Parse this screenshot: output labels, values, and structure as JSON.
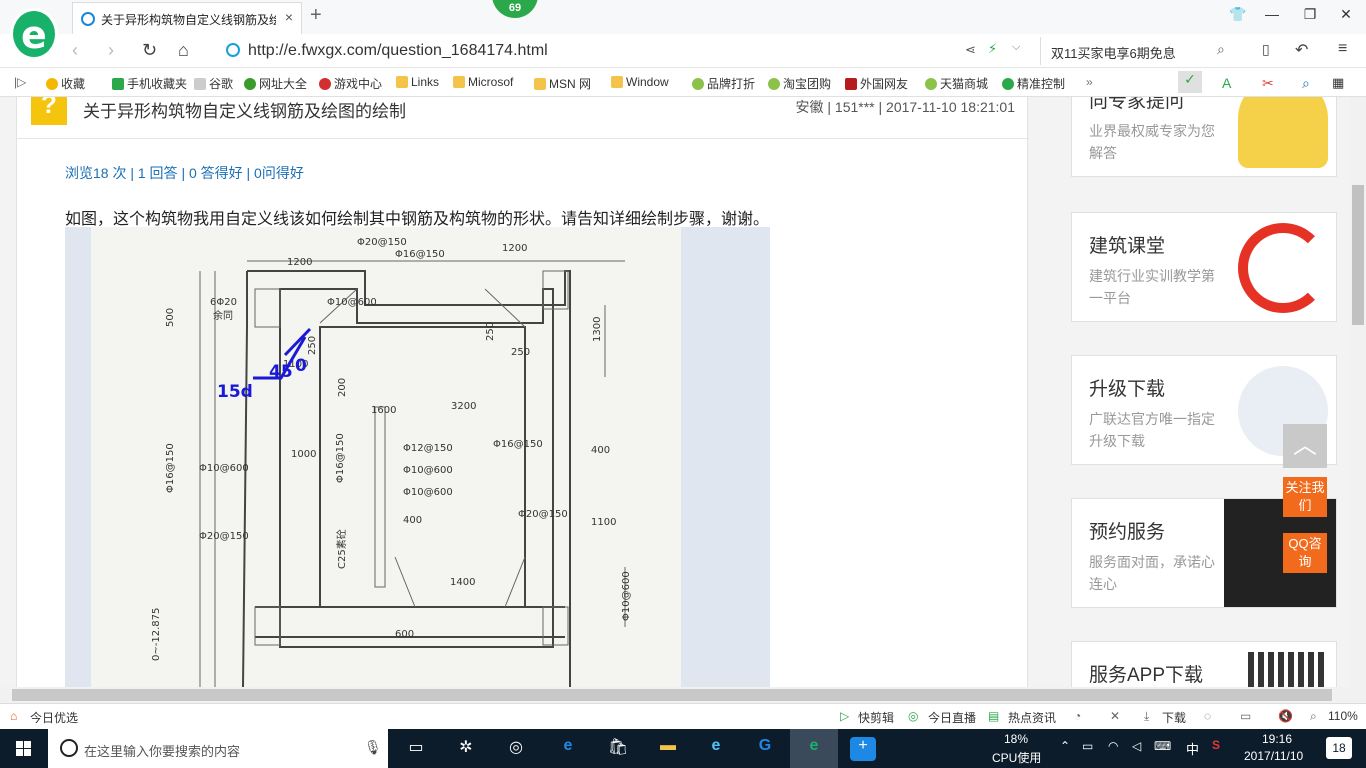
{
  "browser": {
    "tab_title": "关于异形构筑物自定义线钢筋及绘",
    "tab_close": "×",
    "new_tab": "+",
    "badge": "69",
    "url": "http://e.fwxgx.com/question_1684174.html",
    "search_text": "双11买家电享6期免息"
  },
  "bookmarks": [
    "收藏",
    "手机收藏夹",
    "谷歌",
    "网址大全",
    "游戏中心",
    "Links",
    "Microsof",
    "MSN 网",
    "Window",
    "品牌打折",
    "淘宝团购",
    "外国网友",
    "天猫商城",
    "精准控制"
  ],
  "question": {
    "title": "关于异形构筑物自定义线钢筋及绘图的绘制",
    "meta": "安徽 | 151*** | 2017-11-10 18:21:01",
    "stats": "浏览18 次 | 1 回答 | 0 答得好 | 0问得好",
    "body": "如图，这个构筑物我用自定义线该如何绘制其中钢筋及构筑物的形状。请告知详细绘制步骤，谢谢。"
  },
  "drawing": {
    "dims": [
      "1200",
      "Φ20@150",
      "1200",
      "Φ16@150",
      "500",
      "Φ10@600",
      "6Φ20",
      "余同",
      "1300",
      "250",
      "250",
      "250",
      "1100",
      "200",
      "1600",
      "3200",
      "Φ16@150",
      "Φ10@600",
      "1000",
      "Φ16@150",
      "Φ12@150",
      "Φ10@600",
      "Φ10@600",
      "Φ16@150",
      "400",
      "400",
      "Φ20@150",
      "Φ20@150",
      "1100",
      "C25素砼",
      "1400",
      "Φ10@600",
      "600",
      "0~-12.875"
    ],
    "annot_15d": "15d",
    "annot_45": "45",
    "annot_0": "0"
  },
  "sidebar": [
    {
      "title": "向专家提问",
      "sub": "业界最权威专家为您解答"
    },
    {
      "title": "建筑课堂",
      "sub": "建筑行业实训教学第一平台"
    },
    {
      "title": "升级下载",
      "sub": "广联达官方唯一指定升级下载"
    },
    {
      "title": "预约服务",
      "sub": "服务面对面，承诺心连心"
    },
    {
      "title": "服务APP下载",
      "sub": ""
    }
  ],
  "floating": {
    "follow": "关注我们",
    "qq": "QQ咨询"
  },
  "statusbar": {
    "left": "今日优选",
    "items": [
      "快剪辑",
      "今日直播",
      "热点资讯",
      "下载"
    ],
    "zoom": "110%"
  },
  "taskbar": {
    "search_placeholder": "在这里输入你要搜索的内容",
    "cpu": "18%",
    "cpu_label": "CPU使用",
    "ime": "中",
    "time": "19:16",
    "date": "2017/11/10",
    "notif": "18"
  },
  "colors": {
    "accent": "#17b169",
    "link": "#1a6fb5",
    "orange": "#f26b1d",
    "annot": "#1a1ad6"
  }
}
